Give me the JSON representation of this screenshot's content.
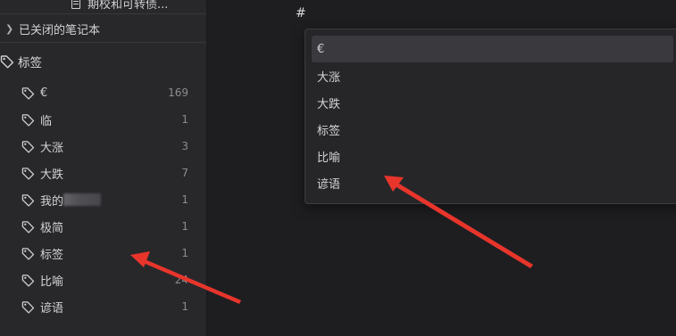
{
  "sidebar": {
    "note_title": "期校和可转债...",
    "closed_notebooks_label": "已关闭的笔记本",
    "tags_section_label": "标签",
    "tags": [
      {
        "label": "€",
        "count": "169"
      },
      {
        "label": "临",
        "count": "1"
      },
      {
        "label": "大涨",
        "count": "3"
      },
      {
        "label": "大跌",
        "count": "7"
      },
      {
        "label": "我的",
        "count": "1",
        "obscured": true
      },
      {
        "label": "极简",
        "count": "1"
      },
      {
        "label": "标签",
        "count": "1"
      },
      {
        "label": "比喻",
        "count": "24"
      },
      {
        "label": "谚语",
        "count": "1"
      }
    ]
  },
  "editor": {
    "typed_text": "#"
  },
  "suggestions": {
    "items": [
      "€",
      "大涨",
      "大跌",
      "标签",
      "比喻",
      "谚语"
    ],
    "selected": "€"
  },
  "colors": {
    "annotation_arrow": "#e8352b",
    "sidebar_bg": "#28282b",
    "editor_bg": "#1e1e21"
  },
  "icons": {
    "tag": "tag-icon",
    "chevron": "chevron-right-icon",
    "note": "document-icon"
  }
}
